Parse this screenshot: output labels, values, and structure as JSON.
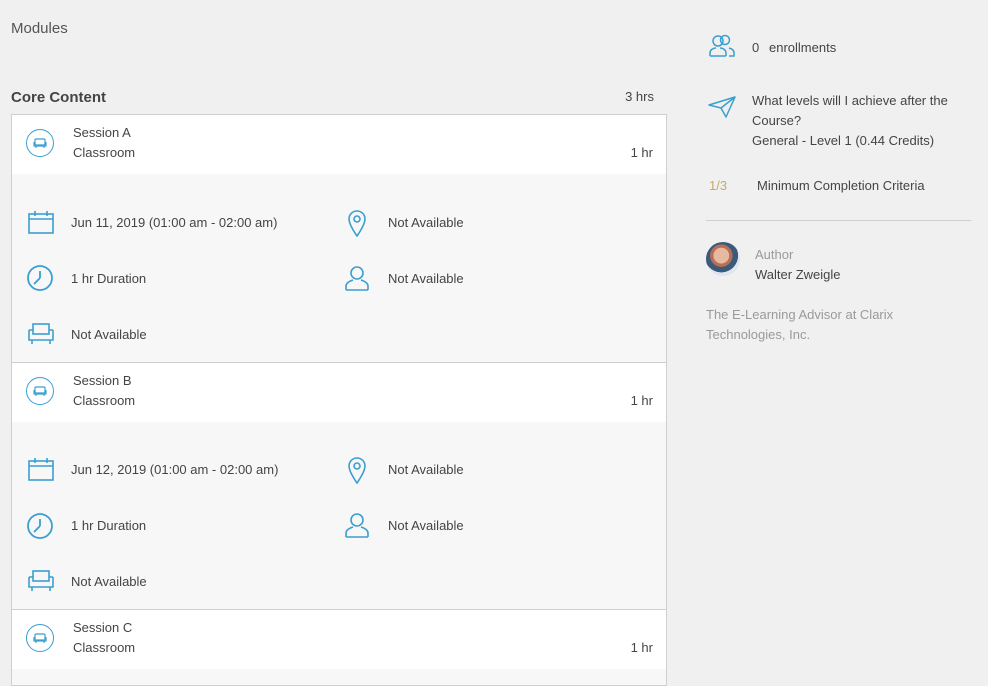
{
  "modules_label": "Modules",
  "section": {
    "title": "Core Content",
    "hours": "3 hrs"
  },
  "sessions": [
    {
      "name": "Session A",
      "type": "Classroom",
      "duration": "1 hr",
      "date": "Jun 11, 2019 (01:00 am - 02:00 am)",
      "location": "Not Available",
      "duration_text": "1 hr Duration",
      "instructor": "Not Available",
      "room": "Not Available"
    },
    {
      "name": "Session B",
      "type": "Classroom",
      "duration": "1 hr",
      "date": "Jun 12, 2019 (01:00 am - 02:00 am)",
      "location": "Not Available",
      "duration_text": "1 hr Duration",
      "instructor": "Not Available",
      "room": "Not Available"
    },
    {
      "name": "Session C",
      "type": "Classroom",
      "duration": "1 hr"
    }
  ],
  "sidebar": {
    "enrollments_count": "0",
    "enrollments_label": "enrollments",
    "levels_question_line1": "What levels will I achieve after the",
    "levels_question_line2": "Course?",
    "level_value": "General - Level 1 (0.44 Credits)",
    "completion_fraction": "1/3",
    "completion_label": "Minimum Completion Criteria",
    "author_label": "Author",
    "author_name": "Walter Zweigle",
    "author_bio_line1": "The E-Learning Advisor at Clarix",
    "author_bio_line2": "Technologies, Inc."
  },
  "colors": {
    "accent": "#3a9fd0",
    "fraction": "#c9a86a"
  }
}
